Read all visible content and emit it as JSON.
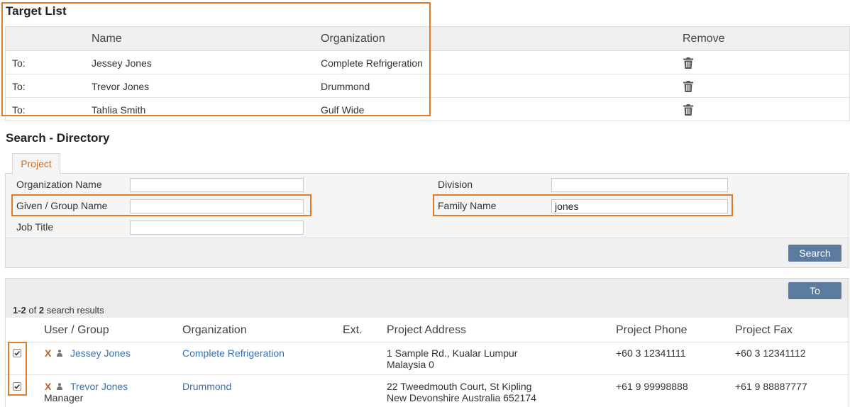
{
  "target_list": {
    "title": "Target List",
    "headers": {
      "name": "Name",
      "organization": "Organization",
      "remove": "Remove"
    },
    "rows": [
      {
        "to": "To:",
        "name": "Jessey Jones",
        "organization": "Complete Refrigeration",
        "remove_icon": "trash-icon"
      },
      {
        "to": "To:",
        "name": "Trevor Jones",
        "organization": "Drummond",
        "remove_icon": "trash-icon"
      },
      {
        "to": "To:",
        "name": "Tahlia Smith",
        "organization": "Gulf Wide",
        "remove_icon": "trash-icon"
      }
    ]
  },
  "search": {
    "title": "Search - Directory",
    "tab": "Project",
    "fields": {
      "organization_name": {
        "label": "Organization Name",
        "value": ""
      },
      "given_name": {
        "label": "Given / Group Name",
        "value": ""
      },
      "job_title": {
        "label": "Job Title",
        "value": ""
      },
      "division": {
        "label": "Division",
        "value": ""
      },
      "family_name": {
        "label": "Family Name",
        "value": "jones"
      }
    },
    "search_button": "Search"
  },
  "results": {
    "to_button": "To",
    "count": {
      "range": "1-2",
      "of": "of",
      "total": "2",
      "suffix": "search results"
    },
    "headers": {
      "user_group": "User / Group",
      "organization": "Organization",
      "ext": "Ext.",
      "project_address": "Project Address",
      "project_phone": "Project Phone",
      "project_fax": "Project Fax"
    },
    "rows": [
      {
        "checked": true,
        "name": "Jessey Jones",
        "subtitle": "",
        "organization": "Complete Refrigeration",
        "ext": "",
        "address_line1": "1 Sample Rd., Kualar Lumpur",
        "address_line2": "Malaysia 0",
        "phone": "+60 3 12341111",
        "fax": "+60 3 12341112"
      },
      {
        "checked": true,
        "name": "Trevor Jones",
        "subtitle": "Manager",
        "organization": "Drummond",
        "ext": "",
        "address_line1": "22 Tweedmouth Court, St Kipling",
        "address_line2": "New Devonshire Australia 652174",
        "phone": "+61 9 99998888",
        "fax": "+61 9 88887777"
      }
    ]
  },
  "colors": {
    "accent_orange": "#e07b27",
    "button_blue": "#5b7c9f",
    "link_blue": "#3a70b2"
  }
}
